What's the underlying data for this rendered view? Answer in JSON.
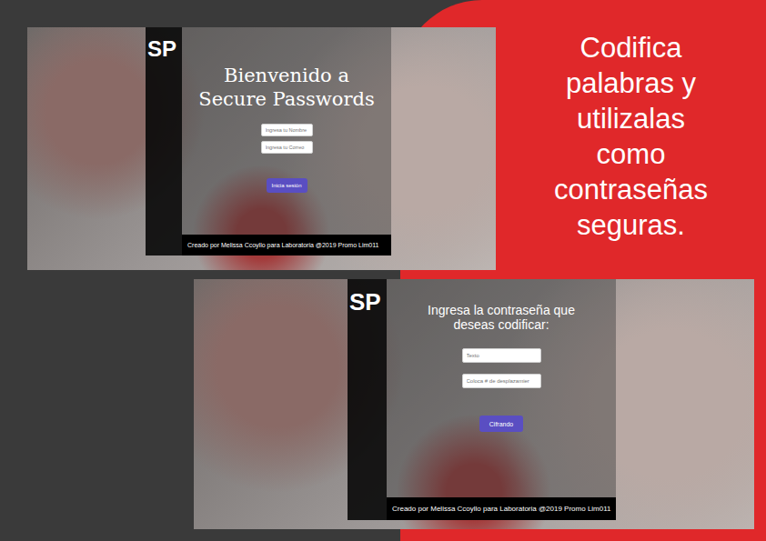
{
  "slide": {
    "tagline": [
      "Codifica",
      "palabras y",
      "utilizalas",
      "como",
      "contraseñas",
      "seguras."
    ]
  },
  "screens": [
    {
      "kind": "welcome",
      "logo": "SP",
      "title": "Bienvenido a Secure Passwords",
      "fields": [
        "Ingresa tu Nombre",
        "Ingresa tu Correo"
      ],
      "button": "Inicia sesión",
      "footer": "Creado por Melissa Ccoyllo para Laboratoria @2019 Promo Lim011"
    },
    {
      "kind": "cipher",
      "logo": "SP",
      "title": "Ingresa la contraseña que deseas codificar:",
      "fields": [
        "Texto",
        "Coloca # de desplazamier"
      ],
      "button": "Cifrando",
      "footer": "Creado por Melissa Ccoyllo para Laboratoria @2019 Promo Lim011"
    }
  ]
}
